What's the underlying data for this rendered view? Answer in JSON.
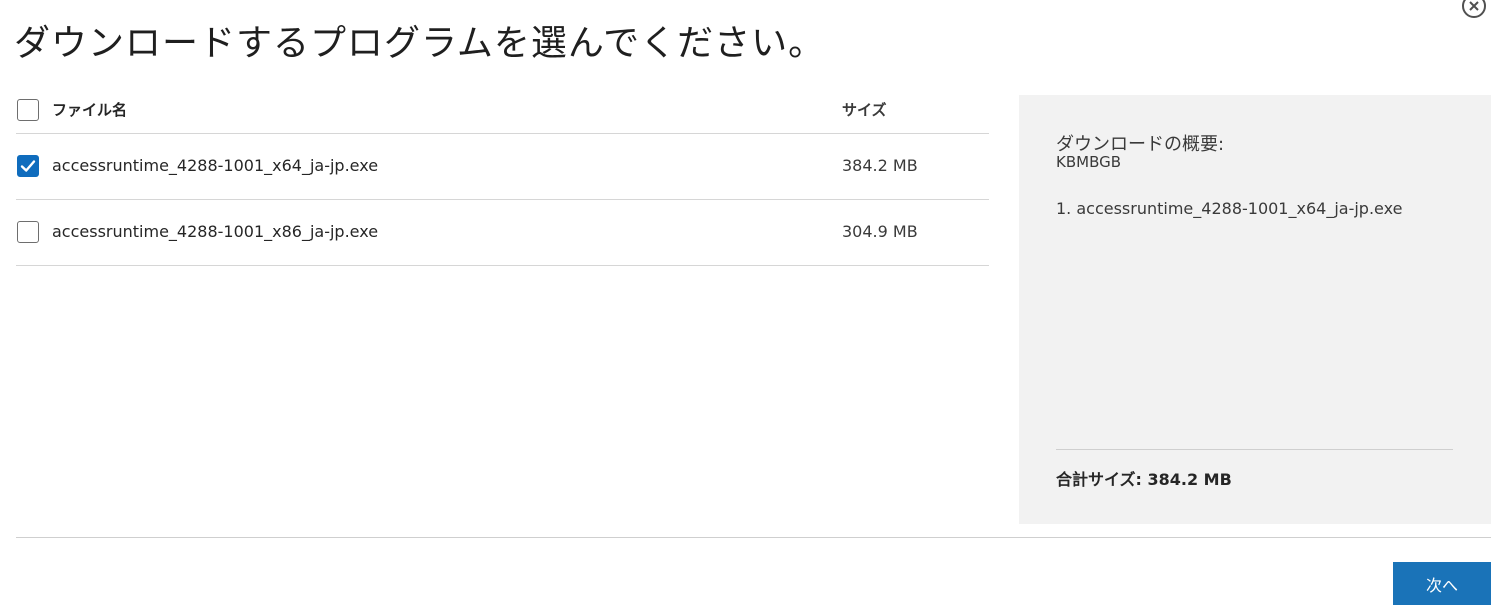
{
  "dialog": {
    "title": "ダウンロードするプログラムを選んでください。",
    "close_icon": "close-circle-icon"
  },
  "table": {
    "header": {
      "name": "ファイル名",
      "size": "サイズ",
      "select_all_checked": false
    },
    "rows": [
      {
        "name": "accessruntime_4288-1001_x64_ja-jp.exe",
        "size": "384.2 MB",
        "checked": true
      },
      {
        "name": "accessruntime_4288-1001_x86_ja-jp.exe",
        "size": "304.9 MB",
        "checked": false
      }
    ]
  },
  "summary": {
    "title": "ダウンロードの概要:",
    "kb": "KBMBGB",
    "items": [
      "1. accessruntime_4288-1001_x64_ja-jp.exe"
    ],
    "total": "合計サイズ: 384.2 MB"
  },
  "footer": {
    "next_label": "次へ"
  },
  "colors": {
    "accent": "#0f6cbd",
    "button": "#1a73b8",
    "panel": "#f2f2f2"
  }
}
